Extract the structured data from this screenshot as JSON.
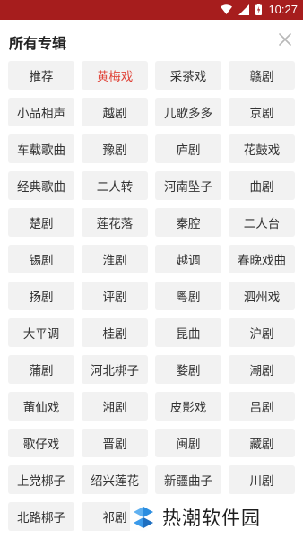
{
  "status_bar": {
    "time": "10:27",
    "color": "#a61d1d"
  },
  "header": {
    "title": "所有专辑",
    "close_icon": "close-icon"
  },
  "albums": [
    {
      "label": "推荐"
    },
    {
      "label": "黄梅戏",
      "active": true
    },
    {
      "label": "采茶戏"
    },
    {
      "label": "赣剧"
    },
    {
      "label": "小品相声"
    },
    {
      "label": "越剧"
    },
    {
      "label": "儿歌多多"
    },
    {
      "label": "京剧"
    },
    {
      "label": "车载歌曲"
    },
    {
      "label": "豫剧"
    },
    {
      "label": "庐剧"
    },
    {
      "label": "花鼓戏"
    },
    {
      "label": "经典歌曲"
    },
    {
      "label": "二人转"
    },
    {
      "label": "河南坠子"
    },
    {
      "label": "曲剧"
    },
    {
      "label": "楚剧"
    },
    {
      "label": "莲花落"
    },
    {
      "label": "秦腔"
    },
    {
      "label": "二人台"
    },
    {
      "label": "锡剧"
    },
    {
      "label": "淮剧"
    },
    {
      "label": "越调"
    },
    {
      "label": "春晚戏曲"
    },
    {
      "label": "扬剧"
    },
    {
      "label": "评剧"
    },
    {
      "label": "粤剧"
    },
    {
      "label": "泗州戏"
    },
    {
      "label": "大平调"
    },
    {
      "label": "桂剧"
    },
    {
      "label": "昆曲"
    },
    {
      "label": "沪剧"
    },
    {
      "label": "蒲剧"
    },
    {
      "label": "河北梆子"
    },
    {
      "label": "婺剧"
    },
    {
      "label": "潮剧"
    },
    {
      "label": "莆仙戏"
    },
    {
      "label": "湘剧"
    },
    {
      "label": "皮影戏"
    },
    {
      "label": "吕剧"
    },
    {
      "label": "歌仔戏"
    },
    {
      "label": "晋剧"
    },
    {
      "label": "闽剧"
    },
    {
      "label": "藏剧"
    },
    {
      "label": "上党梆子"
    },
    {
      "label": "绍兴莲花"
    },
    {
      "label": "新疆曲子"
    },
    {
      "label": "川剧"
    },
    {
      "label": "北路梆子"
    },
    {
      "label": "祁剧"
    }
  ],
  "colors": {
    "active": "#e0453a",
    "tag_bg": "#f2f2f2",
    "text": "#333333"
  },
  "watermark": {
    "text": "热潮软件园"
  }
}
